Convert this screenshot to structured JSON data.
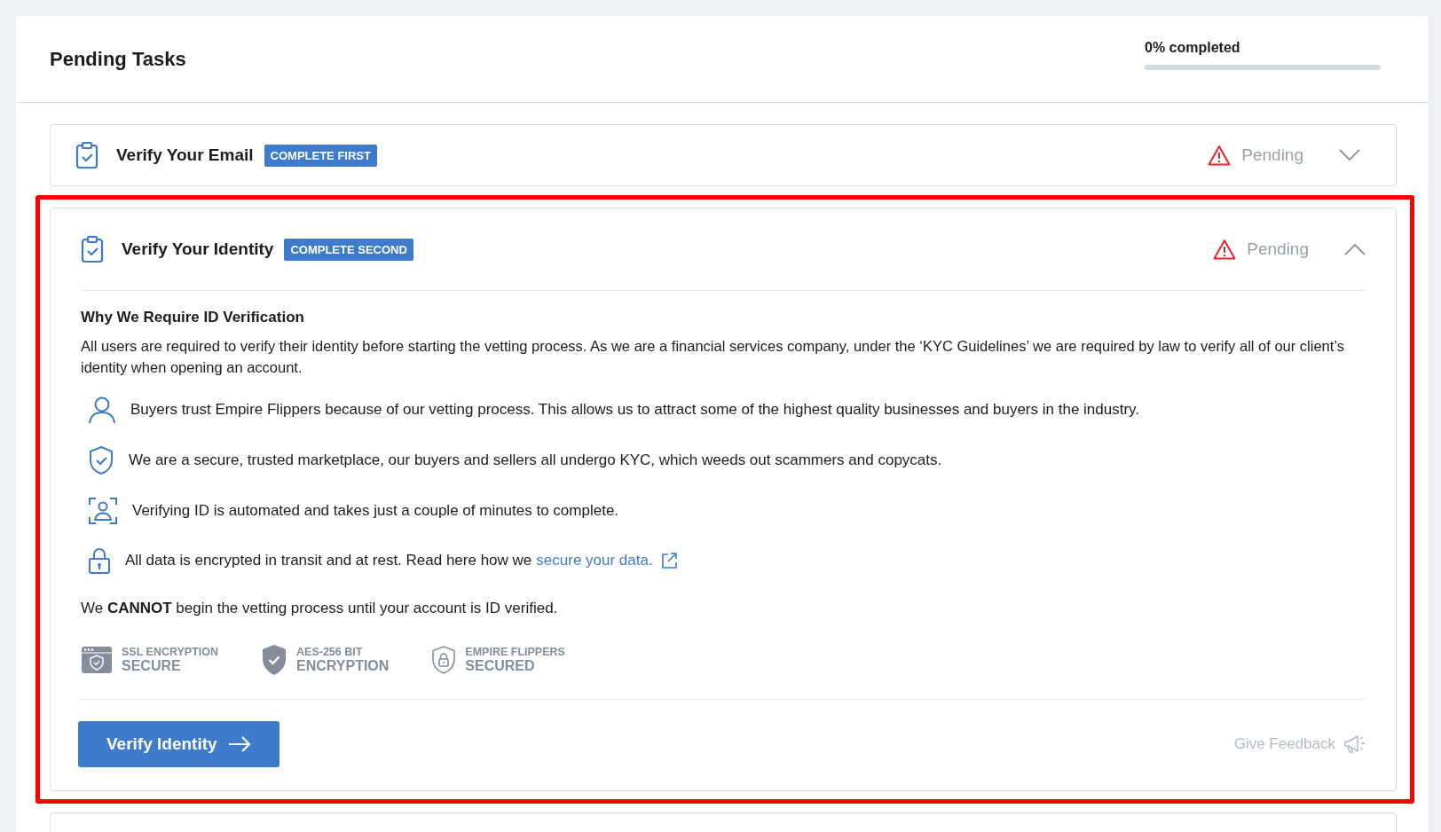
{
  "header": {
    "title": "Pending Tasks",
    "progress_label": "0% completed",
    "progress": {
      "level": 0
    }
  },
  "tasks": [
    {
      "title": "Verify Your Email",
      "badge": "COMPLETE FIRST",
      "status": "Pending",
      "expanded": false,
      "highlighted": false
    },
    {
      "title": "Verify Your Identity",
      "badge": "COMPLETE SECOND",
      "status": "Pending",
      "expanded": true,
      "highlighted": true,
      "details": {
        "heading": "Why We Require ID Verification",
        "intro": "All users are required to verify their identity before starting the vetting process. As we are a financial services company, under the ‘KYC Guidelines’ we are required by law to verify all of our client’s identity when opening an account.",
        "points": [
          {
            "kind": "person",
            "text": "Buyers trust Empire Flippers because of our vetting process. This allows us to attract some of the highest quality businesses and buyers in the industry."
          },
          {
            "kind": "shield",
            "text": "We are a secure, trusted marketplace, our buyers and sellers all undergo KYC, which weeds out scammers and copycats."
          },
          {
            "kind": "scan",
            "text": "Verifying ID is automated and takes just a couple of minutes to complete."
          },
          {
            "kind": "lock",
            "text": "All data is encrypted in transit and at rest. Read here how we",
            "link": "secure your data."
          }
        ],
        "notice": "We **CANNOT** begin the vetting process until your account is ID verified.",
        "seals": [
          {
            "kind": "browser",
            "top": "SSL ENCRYPTION",
            "bottom": "SECURE"
          },
          {
            "kind": "shield",
            "top": "AES-256 BIT",
            "bottom": "ENCRYPTION"
          },
          {
            "kind": "lock",
            "top": "EMPIRE FLIPPERS",
            "bottom": "SECURED"
          }
        ],
        "button": "Verify Identity",
        "feedback": "Give Feedback"
      }
    },
    {
      "kind": "edge"
    }
  ]
}
